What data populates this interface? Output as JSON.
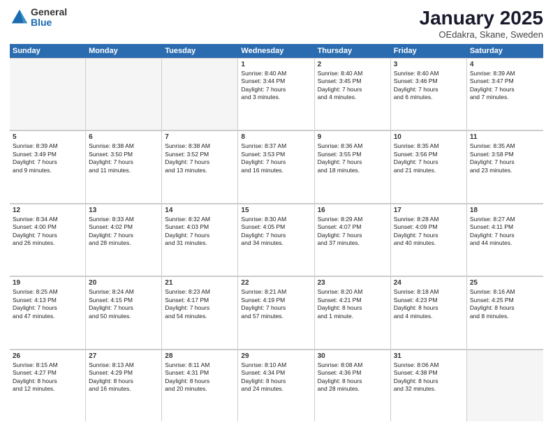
{
  "logo": {
    "general": "General",
    "blue": "Blue"
  },
  "title": "January 2025",
  "subtitle": "OEdakra, Skane, Sweden",
  "dayHeaders": [
    "Sunday",
    "Monday",
    "Tuesday",
    "Wednesday",
    "Thursday",
    "Friday",
    "Saturday"
  ],
  "weeks": [
    [
      {
        "num": "",
        "info": ""
      },
      {
        "num": "",
        "info": ""
      },
      {
        "num": "",
        "info": ""
      },
      {
        "num": "1",
        "info": "Sunrise: 8:40 AM\nSunset: 3:44 PM\nDaylight: 7 hours\nand 3 minutes."
      },
      {
        "num": "2",
        "info": "Sunrise: 8:40 AM\nSunset: 3:45 PM\nDaylight: 7 hours\nand 4 minutes."
      },
      {
        "num": "3",
        "info": "Sunrise: 8:40 AM\nSunset: 3:46 PM\nDaylight: 7 hours\nand 6 minutes."
      },
      {
        "num": "4",
        "info": "Sunrise: 8:39 AM\nSunset: 3:47 PM\nDaylight: 7 hours\nand 7 minutes."
      }
    ],
    [
      {
        "num": "5",
        "info": "Sunrise: 8:39 AM\nSunset: 3:49 PM\nDaylight: 7 hours\nand 9 minutes."
      },
      {
        "num": "6",
        "info": "Sunrise: 8:38 AM\nSunset: 3:50 PM\nDaylight: 7 hours\nand 11 minutes."
      },
      {
        "num": "7",
        "info": "Sunrise: 8:38 AM\nSunset: 3:52 PM\nDaylight: 7 hours\nand 13 minutes."
      },
      {
        "num": "8",
        "info": "Sunrise: 8:37 AM\nSunset: 3:53 PM\nDaylight: 7 hours\nand 16 minutes."
      },
      {
        "num": "9",
        "info": "Sunrise: 8:36 AM\nSunset: 3:55 PM\nDaylight: 7 hours\nand 18 minutes."
      },
      {
        "num": "10",
        "info": "Sunrise: 8:35 AM\nSunset: 3:56 PM\nDaylight: 7 hours\nand 21 minutes."
      },
      {
        "num": "11",
        "info": "Sunrise: 8:35 AM\nSunset: 3:58 PM\nDaylight: 7 hours\nand 23 minutes."
      }
    ],
    [
      {
        "num": "12",
        "info": "Sunrise: 8:34 AM\nSunset: 4:00 PM\nDaylight: 7 hours\nand 26 minutes."
      },
      {
        "num": "13",
        "info": "Sunrise: 8:33 AM\nSunset: 4:02 PM\nDaylight: 7 hours\nand 28 minutes."
      },
      {
        "num": "14",
        "info": "Sunrise: 8:32 AM\nSunset: 4:03 PM\nDaylight: 7 hours\nand 31 minutes."
      },
      {
        "num": "15",
        "info": "Sunrise: 8:30 AM\nSunset: 4:05 PM\nDaylight: 7 hours\nand 34 minutes."
      },
      {
        "num": "16",
        "info": "Sunrise: 8:29 AM\nSunset: 4:07 PM\nDaylight: 7 hours\nand 37 minutes."
      },
      {
        "num": "17",
        "info": "Sunrise: 8:28 AM\nSunset: 4:09 PM\nDaylight: 7 hours\nand 40 minutes."
      },
      {
        "num": "18",
        "info": "Sunrise: 8:27 AM\nSunset: 4:11 PM\nDaylight: 7 hours\nand 44 minutes."
      }
    ],
    [
      {
        "num": "19",
        "info": "Sunrise: 8:25 AM\nSunset: 4:13 PM\nDaylight: 7 hours\nand 47 minutes."
      },
      {
        "num": "20",
        "info": "Sunrise: 8:24 AM\nSunset: 4:15 PM\nDaylight: 7 hours\nand 50 minutes."
      },
      {
        "num": "21",
        "info": "Sunrise: 8:23 AM\nSunset: 4:17 PM\nDaylight: 7 hours\nand 54 minutes."
      },
      {
        "num": "22",
        "info": "Sunrise: 8:21 AM\nSunset: 4:19 PM\nDaylight: 7 hours\nand 57 minutes."
      },
      {
        "num": "23",
        "info": "Sunrise: 8:20 AM\nSunset: 4:21 PM\nDaylight: 8 hours\nand 1 minute."
      },
      {
        "num": "24",
        "info": "Sunrise: 8:18 AM\nSunset: 4:23 PM\nDaylight: 8 hours\nand 4 minutes."
      },
      {
        "num": "25",
        "info": "Sunrise: 8:16 AM\nSunset: 4:25 PM\nDaylight: 8 hours\nand 8 minutes."
      }
    ],
    [
      {
        "num": "26",
        "info": "Sunrise: 8:15 AM\nSunset: 4:27 PM\nDaylight: 8 hours\nand 12 minutes."
      },
      {
        "num": "27",
        "info": "Sunrise: 8:13 AM\nSunset: 4:29 PM\nDaylight: 8 hours\nand 16 minutes."
      },
      {
        "num": "28",
        "info": "Sunrise: 8:11 AM\nSunset: 4:31 PM\nDaylight: 8 hours\nand 20 minutes."
      },
      {
        "num": "29",
        "info": "Sunrise: 8:10 AM\nSunset: 4:34 PM\nDaylight: 8 hours\nand 24 minutes."
      },
      {
        "num": "30",
        "info": "Sunrise: 8:08 AM\nSunset: 4:36 PM\nDaylight: 8 hours\nand 28 minutes."
      },
      {
        "num": "31",
        "info": "Sunrise: 8:06 AM\nSunset: 4:38 PM\nDaylight: 8 hours\nand 32 minutes."
      },
      {
        "num": "",
        "info": ""
      }
    ]
  ]
}
